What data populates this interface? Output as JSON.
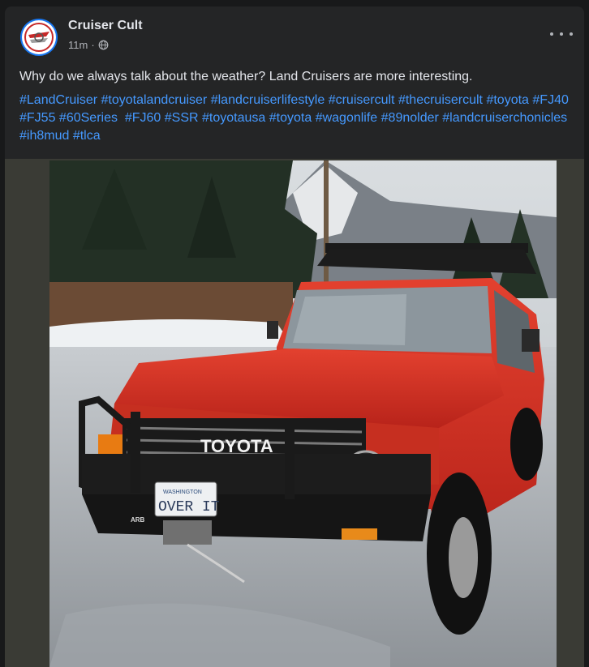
{
  "post": {
    "page_name": "Cruiser Cult",
    "timestamp": "11m",
    "separator": "·",
    "audience_icon": "globe-icon",
    "more_icon": "ellipsis-icon",
    "caption": "Why do we always talk about the weather? Land Cruisers are more interesting.",
    "hashtags": [
      "#LandCruiser",
      "#toyotalandcruiser",
      "#landcruiserlifestyle",
      "#cruisercult",
      "#thecruisercult",
      "#toyota",
      "#FJ40",
      "#FJ55",
      "#60Series",
      "#FJ60",
      "#SSR",
      "#toyotausa",
      "#toyota",
      "#wagonlife",
      "#89nolder",
      "#landcruiserchonicles",
      "#ih8mud",
      "#tlca"
    ]
  },
  "photo": {
    "grille_text": "TOYOTA",
    "plate_state": "WASHINGTON",
    "plate_text": "OVER IT",
    "bumper_badge": "ARB"
  },
  "colors": {
    "background": "#18191a",
    "card": "#242526",
    "text_primary": "#e4e6eb",
    "text_secondary": "#b0b3b8",
    "link": "#4599ff",
    "avatar_ring": "#1877f2",
    "vehicle_red": "#d52a1c"
  }
}
